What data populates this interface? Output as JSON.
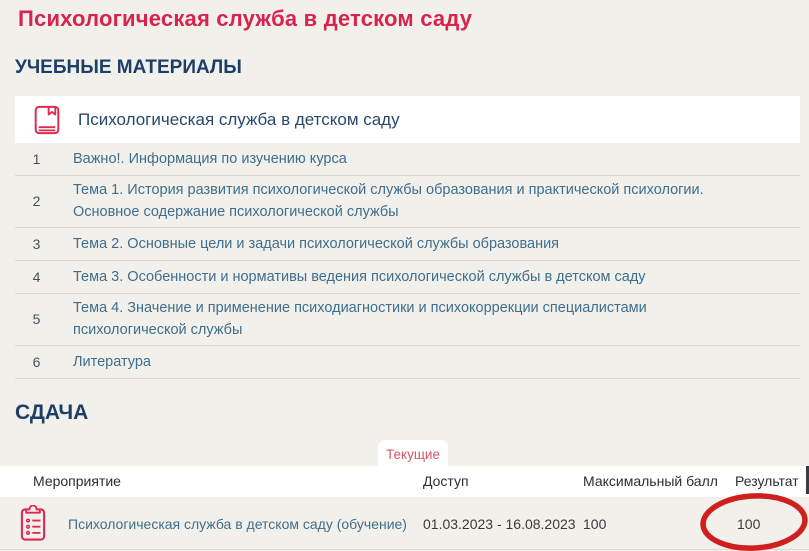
{
  "page": {
    "title": "Психологическая служба в детском саду"
  },
  "materials": {
    "heading": "УЧЕБНЫЕ МАТЕРИАЛЫ",
    "card_title": "Психологическая служба в детском саду",
    "items": [
      {
        "num": "1",
        "label": "Важно!. Информация по изучению курса"
      },
      {
        "num": "2",
        "label": "Тема 1. История развития психологической службы образования и практической психологии. Основное содержание психологической службы"
      },
      {
        "num": "3",
        "label": "Тема 2. Основные цели и задачи психологической службы образования"
      },
      {
        "num": "4",
        "label": "Тема 3. Особенности и нормативы ведения психологической службы в детском саду"
      },
      {
        "num": "5",
        "label": "Тема 4. Значение и применение психодиагностики и психокоррекции специалистами психологической службы"
      },
      {
        "num": "6",
        "label": "Литература"
      }
    ]
  },
  "submission": {
    "heading": "СДАЧА",
    "tab": "Текущие",
    "columns": [
      "Мероприятие",
      "Доступ",
      "Максимальный балл",
      "Результат"
    ],
    "row": {
      "event": "Психологическая служба в детском саду (обучение)",
      "access": "01.03.2023 - 16.08.2023",
      "max_score": "100",
      "result": "100"
    }
  },
  "icons": {
    "course": "book-icon",
    "event": "clipboard-checklist-icon",
    "annotation": "hand-drawn-red-circle"
  },
  "colors": {
    "background": "#f2f0ea",
    "title_red": "#d8234f",
    "heading_navy": "#1d3e66",
    "link_blue": "#3f6e8e",
    "icon_red": "#e02850",
    "tab_red": "#d4566a",
    "annotation_red": "#cf1f1f",
    "divider": "#dcdad2"
  }
}
